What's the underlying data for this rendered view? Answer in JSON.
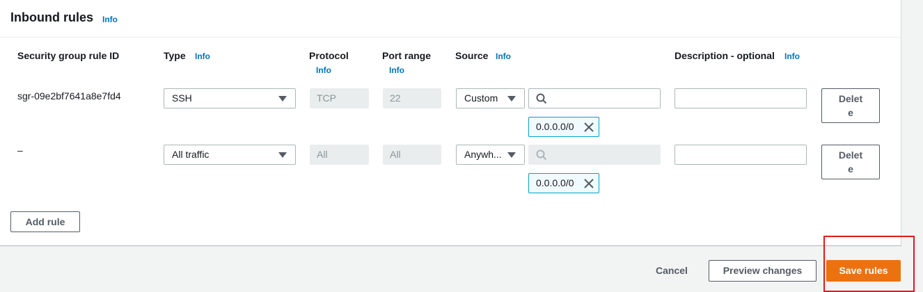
{
  "section": {
    "title": "Inbound rules",
    "info": "Info"
  },
  "columns": {
    "rule_id": "Security group rule ID",
    "type": "Type",
    "type_info": "Info",
    "protocol": "Protocol",
    "protocol_info": "Info",
    "port_range": "Port range",
    "port_range_info": "Info",
    "source": "Source",
    "source_info": "Info",
    "description": "Description - optional",
    "description_info": "Info"
  },
  "rules": [
    {
      "rule_id": "sgr-09e2bf7641a8e7fd4",
      "type": "SSH",
      "protocol": "TCP",
      "port_range": "22",
      "source_type": "Custom",
      "source_token": "0.0.0.0/0",
      "description": "",
      "delete_label_1": "Delet",
      "delete_label_2": "e"
    },
    {
      "rule_id": "–",
      "type": "All traffic",
      "protocol": "All",
      "port_range": "All",
      "source_type": "Anywh...",
      "source_token": "0.0.0.0/0",
      "description": "",
      "delete_label_1": "Delet",
      "delete_label_2": "e"
    }
  ],
  "actions": {
    "add_rule": "Add rule",
    "cancel": "Cancel",
    "preview": "Preview changes",
    "save": "Save rules"
  },
  "colors": {
    "primary": "#ec7211",
    "link": "#0073bb",
    "highlight": "#e3161b",
    "token_border": "#00a1c9"
  }
}
